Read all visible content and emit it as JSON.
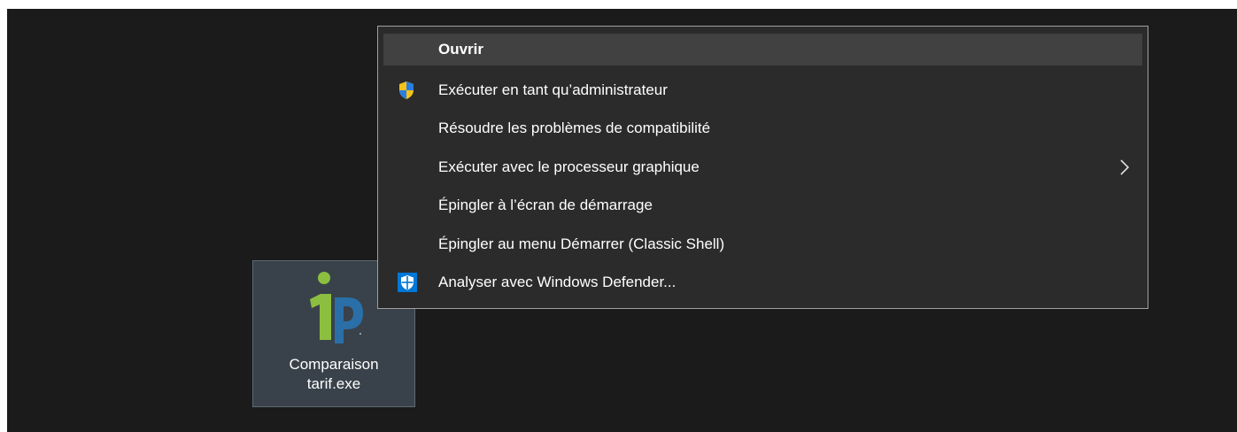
{
  "desktop": {
    "file": {
      "icon": "app-logo-icon",
      "label": "Comparaison\ntarif.exe"
    }
  },
  "context_menu": {
    "items": [
      {
        "label": "Ouvrir",
        "bold": true,
        "highlighted": true,
        "icon": null
      },
      {
        "label": "Exécuter en tant qu’administrateur",
        "icon": "uac-shield-icon"
      },
      {
        "label": "Résoudre les problèmes de compatibilité",
        "icon": null
      },
      {
        "label": "Exécuter avec le processeur graphique",
        "icon": null,
        "submenu": true
      },
      {
        "label": "Épingler à l’écran de démarrage",
        "icon": null
      },
      {
        "label": "Épingler au menu Démarrer (Classic Shell)",
        "icon": null
      },
      {
        "label": "Analyser avec Windows Defender...",
        "icon": "windows-defender-icon"
      }
    ]
  },
  "colors": {
    "desktop_bg": "#1b1b1b",
    "menu_bg": "#2b2b2b",
    "menu_highlight": "#414141",
    "selection_bg": "#39424a",
    "logo_green": "#8cbf3f",
    "logo_blue": "#2a6fa8",
    "defender_blue": "#0078d7"
  }
}
